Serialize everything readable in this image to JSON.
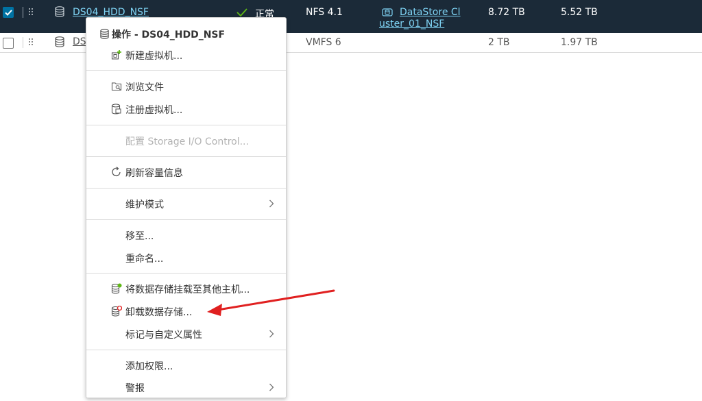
{
  "rows": [
    {
      "name": "DS04_HDD_NSF",
      "status": "正常",
      "type": "NFS 4.1",
      "cluster": "DataStore Cluster_01_NSF",
      "cluster_line1": "DataStore Cl",
      "cluster_line2": "uster_01_NSF",
      "capacity": "8.72 TB",
      "free": "5.52 TB",
      "selected": true
    },
    {
      "name": "DS",
      "type": "VMFS 6",
      "capacity": "2 TB",
      "free": "1.97 TB",
      "selected": false
    }
  ],
  "menu": {
    "title": "操作 - DS04_HDD_NSF",
    "items": [
      {
        "label": "新建虚拟机...",
        "icon": "new-vm-icon"
      },
      {
        "label": "浏览文件",
        "icon": "browse-files-icon"
      },
      {
        "label": "注册虚拟机...",
        "icon": "register-vm-icon"
      },
      {
        "label": "配置 Storage I/O Control...",
        "icon": "",
        "disabled": true
      },
      {
        "label": "刷新容量信息",
        "icon": "refresh-icon"
      },
      {
        "label": "维护模式",
        "icon": "",
        "submenu": true
      },
      {
        "label": "移至...",
        "icon": ""
      },
      {
        "label": "重命名...",
        "icon": ""
      },
      {
        "label": "将数据存储挂载至其他主机...",
        "icon": "mount-datastore-icon"
      },
      {
        "label": "卸载数据存储...",
        "icon": "unmount-datastore-icon"
      },
      {
        "label": "标记与自定义属性",
        "icon": "",
        "submenu": true
      },
      {
        "label": "添加权限...",
        "icon": ""
      },
      {
        "label": "警报",
        "icon": "",
        "submenu": true
      }
    ]
  },
  "colors": {
    "selected_row_bg": "#1b2a38",
    "link": "#0072a3",
    "ok_green": "#5eb715",
    "arrow_red": "#e02020"
  }
}
